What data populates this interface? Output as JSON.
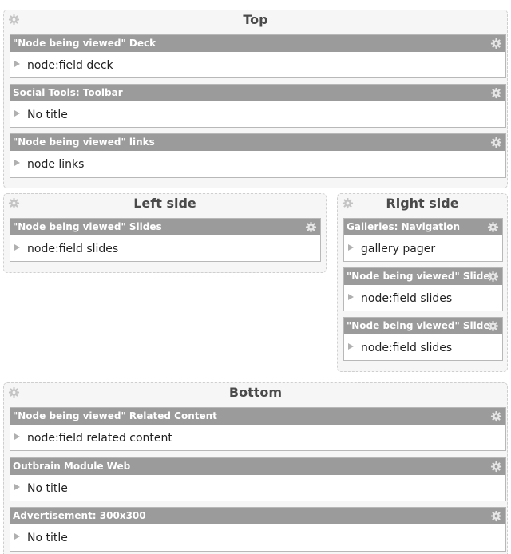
{
  "regions": {
    "top": {
      "title": "Top",
      "panes": [
        {
          "header": "\"Node being viewed\" Deck",
          "label": "node:field deck"
        },
        {
          "header": "Social Tools: Toolbar",
          "label": "No title"
        },
        {
          "header": "\"Node being viewed\" links",
          "label": "node links"
        }
      ]
    },
    "left": {
      "title": "Left side",
      "panes": [
        {
          "header": "\"Node being viewed\" Slides",
          "label": "node:field slides"
        }
      ]
    },
    "right": {
      "title": "Right side",
      "panes": [
        {
          "header": "Galleries: Navigation",
          "label": "gallery pager"
        },
        {
          "header": "\"Node being viewed\" Slides",
          "label": "node:field slides"
        },
        {
          "header": "\"Node being viewed\" Slides",
          "label": "node:field slides"
        }
      ]
    },
    "bottom": {
      "title": "Bottom",
      "panes": [
        {
          "header": "\"Node being viewed\" Related Content",
          "label": "node:field related content"
        },
        {
          "header": "Outbrain Module Web",
          "label": "No title"
        },
        {
          "header": "Advertisement: 300x300",
          "label": "No title"
        }
      ]
    }
  },
  "icons": {
    "region_gear": "gear-icon",
    "pane_gear": "gear-icon",
    "pane_arrow": "arrow-right-icon"
  },
  "colors": {
    "header_bg": "#9b9b9b",
    "region_bg": "#f6f6f6",
    "title_text": "#4a4a4a"
  }
}
